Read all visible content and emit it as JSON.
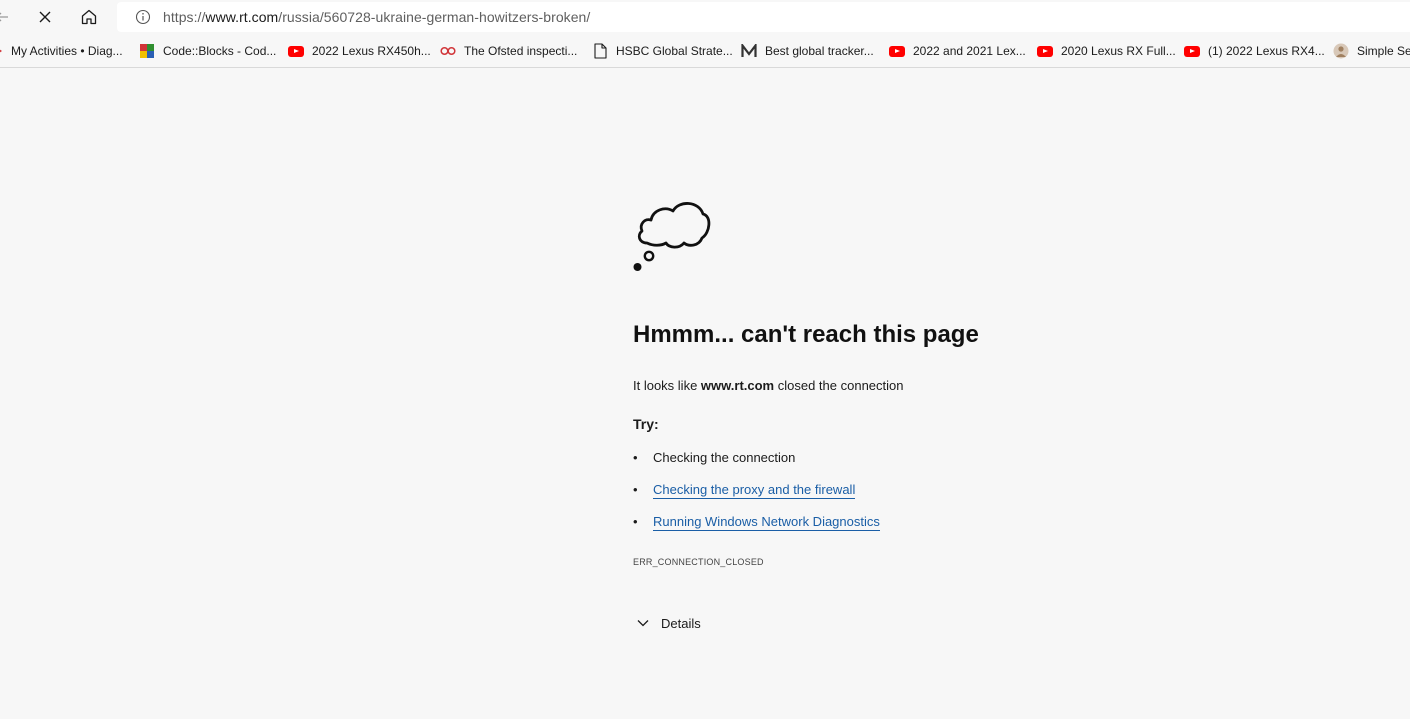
{
  "toolbar": {
    "url_prefix": "https://",
    "url_host": "www.rt.com",
    "url_path": "/russia/560728-ukraine-german-howitzers-broken/"
  },
  "bookmarks": [
    {
      "label": "My Activities • Diag...",
      "icon": "red-arrow-icon"
    },
    {
      "label": "Code::Blocks - Cod...",
      "icon": "codeblocks-icon"
    },
    {
      "label": "2022 Lexus RX450h...",
      "icon": "youtube-icon"
    },
    {
      "label": "The Ofsted inspecti...",
      "icon": "ofsted-icon"
    },
    {
      "label": "HSBC Global Strate...",
      "icon": "document-icon"
    },
    {
      "label": "Best global tracker...",
      "icon": "medium-icon"
    },
    {
      "label": "2022 and 2021 Lex...",
      "icon": "youtube-icon"
    },
    {
      "label": "2020 Lexus RX Full...",
      "icon": "youtube-icon"
    },
    {
      "label": "(1) 2022 Lexus RX4...",
      "icon": "youtube-icon"
    },
    {
      "label": "Simple Sea",
      "icon": "avatar-icon"
    }
  ],
  "error": {
    "heading": "Hmmm... can't reach this page",
    "lead_before": "It looks like ",
    "lead_host": "www.rt.com",
    "lead_after": " closed the connection",
    "try_label": "Try:",
    "suggestions": [
      {
        "text": "Checking the connection",
        "is_link": false
      },
      {
        "text": "Checking the proxy and the firewall",
        "is_link": true
      },
      {
        "text": "Running Windows Network Diagnostics",
        "is_link": true
      }
    ],
    "code": "ERR_CONNECTION_CLOSED",
    "details_label": "Details"
  },
  "colors": {
    "background": "#f7f7f7",
    "link": "#1a5ea6",
    "youtube": "#ff0000"
  }
}
